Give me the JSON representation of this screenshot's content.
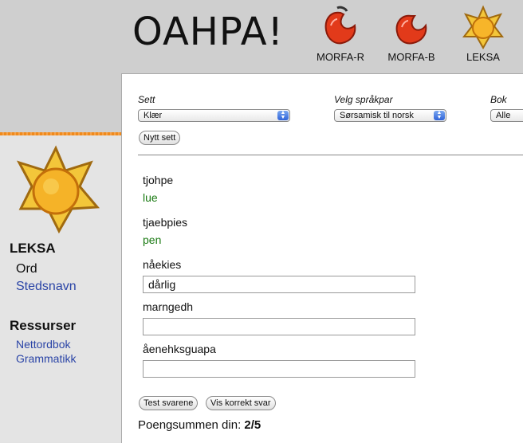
{
  "header": {
    "logo": "OAHPA!",
    "nav": [
      {
        "label": "MORFA-R",
        "icon": "red-apple-icon"
      },
      {
        "label": "MORFA-B",
        "icon": "red-apple-icon"
      },
      {
        "label": "LEKSA",
        "icon": "sun-star-icon"
      }
    ]
  },
  "sidebar": {
    "section1": "LEKSA",
    "items1": [
      "Ord",
      "Stedsnavn"
    ],
    "section2": "Ressurser",
    "items2": [
      "Nettordbok",
      "Grammatikk"
    ]
  },
  "filters": {
    "sett_label": "Sett",
    "sett_value": "Klær",
    "pair_label": "Velg språkpar",
    "pair_value": "Sørsamisk til norsk",
    "bok_label": "Bok",
    "bok_value": "Alle",
    "new_set": "Nytt sett"
  },
  "exercise": {
    "words": [
      "tjohpe",
      "tjaebpies",
      "nåekies",
      "marngedh",
      "åenehksguapa"
    ],
    "answers": [
      "lue",
      "pen"
    ],
    "inputs": [
      "dårlig",
      "",
      ""
    ]
  },
  "buttons": {
    "test": "Test svarene",
    "show": "Vis korrekt svar"
  },
  "score": {
    "label": "Poengsummen din:",
    "value": "2/5"
  },
  "colors": {
    "link": "#2a44a6",
    "correct": "#1a7a12",
    "accent": "#f08a1c"
  }
}
